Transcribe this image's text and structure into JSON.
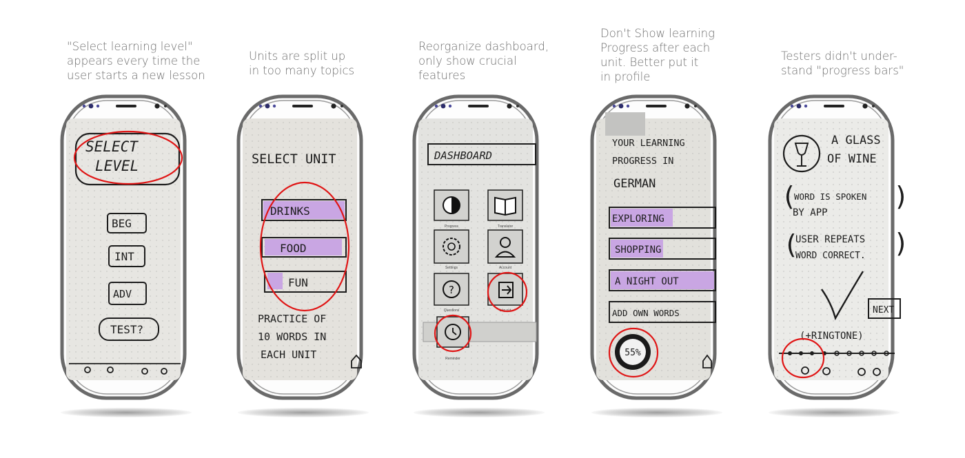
{
  "captions": [
    "\"Select learning level\"\nappears every time the\nuser starts a new lesson",
    "Units are split up\nin too many topics",
    "Reorganize dashboard,\nonly show crucial\nfeatures",
    "Don't Show learning\nProgress after each\nunit. Better put it\nin profile",
    "Testers didn't under-\nstand \"progress bars\""
  ],
  "screen1": {
    "title_line1": "SELECT",
    "title_line2": "LEVEL",
    "options": [
      "BEG",
      "INT",
      "ADV",
      "TEST?"
    ]
  },
  "screen2": {
    "title": "SELECT UNIT",
    "units": [
      "DRINKS",
      "FOOD",
      "FUN"
    ],
    "note_line1": "PRACTICE OF",
    "note_line2": "10 WORDS IN",
    "note_line3": "EACH UNIT"
  },
  "screen3": {
    "title": "DASHBOARD",
    "tiles": [
      "Progress",
      "Translator",
      "Settings",
      "Account",
      "Questions",
      "Log out",
      "Reminder"
    ]
  },
  "screen4": {
    "title_line1": "YOUR LEARNING",
    "title_line2": "PROGRESS IN",
    "title_line3": "GERMAN",
    "items": [
      "EXPLORING",
      "SHOPPING",
      "A NIGHT OUT",
      "ADD OWN WORDS"
    ],
    "percent": "55%"
  },
  "screen5": {
    "heading_line1": "A GLASS",
    "heading_line2": "OF WINE",
    "note1_line1": "WORD IS SPOKEN",
    "note1_line2": "BY APP",
    "note2_line1": "USER REPEATS",
    "note2_line2": "WORD CORRECT.",
    "next_label": "NEXT",
    "ringtone": "(+RINGTONE)"
  },
  "colors": {
    "highlight": "#c9a6e3",
    "annotation": "#e01515",
    "phone_frame": "#6a6a6a",
    "caption": "#6e6e6e"
  }
}
